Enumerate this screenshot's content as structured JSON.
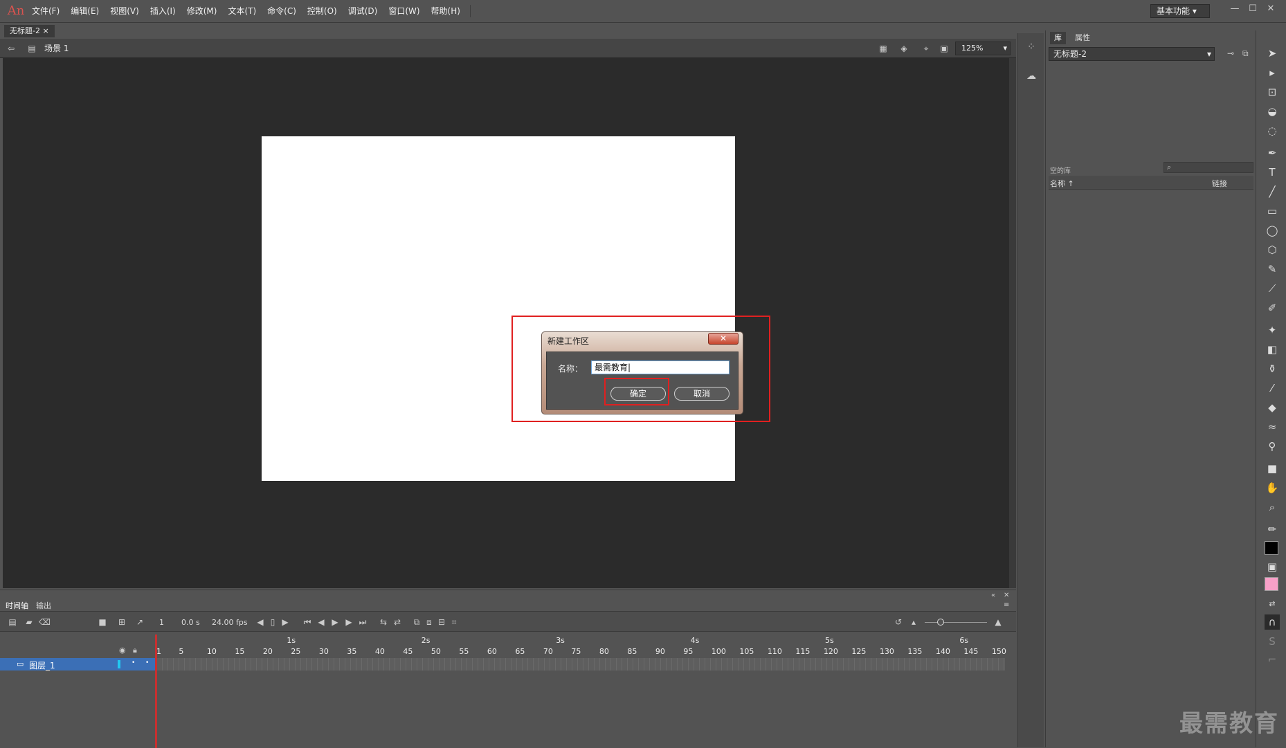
{
  "app": {
    "logo": "An",
    "menu": [
      "文件(F)",
      "编辑(E)",
      "视图(V)",
      "插入(I)",
      "修改(M)",
      "文本(T)",
      "命令(C)",
      "控制(O)",
      "调试(D)",
      "窗口(W)",
      "帮助(H)"
    ],
    "workspace_label": "基本功能",
    "window_controls": [
      "—",
      "☐",
      "✕"
    ]
  },
  "document": {
    "tab_label": "无标题-2",
    "tab_close": "×",
    "scene_label": "场景 1",
    "zoom": "125%"
  },
  "dialog": {
    "title": "新建工作区",
    "close_glyph": "✕",
    "name_label": "名称：",
    "name_value": "最需教育|",
    "ok_label": "确定",
    "cancel_label": "取消"
  },
  "library": {
    "tabs": [
      "库",
      "属性"
    ],
    "selected_document": "无标题-2",
    "item_count_label": "空的库",
    "search_glyph": "⌕",
    "col_name": "名称 ↑",
    "col_linkage": "链接"
  },
  "timeline": {
    "tabs": [
      "时间轴",
      "输出"
    ],
    "current_frame": "1",
    "elapsed": "0.0 s",
    "fps": "24.00 fps",
    "seconds": [
      "1s",
      "2s",
      "3s",
      "4s",
      "5s",
      "6s"
    ],
    "frame_numbers": [
      "1",
      "5",
      "10",
      "15",
      "20",
      "25",
      "30",
      "35",
      "40",
      "45",
      "50",
      "55",
      "60",
      "65",
      "70",
      "75",
      "80",
      "85",
      "90",
      "95",
      "100",
      "105",
      "110",
      "115",
      "120",
      "125",
      "130",
      "135",
      "140",
      "145",
      "150"
    ],
    "layer_name": "图层_1"
  },
  "watermark": "最需教育",
  "colors": {
    "accent_red": "#e02020",
    "layer_selection": "#3b6fb6",
    "stroke_swatch": "#000000",
    "fill_swatch": "#f8a0c8"
  }
}
